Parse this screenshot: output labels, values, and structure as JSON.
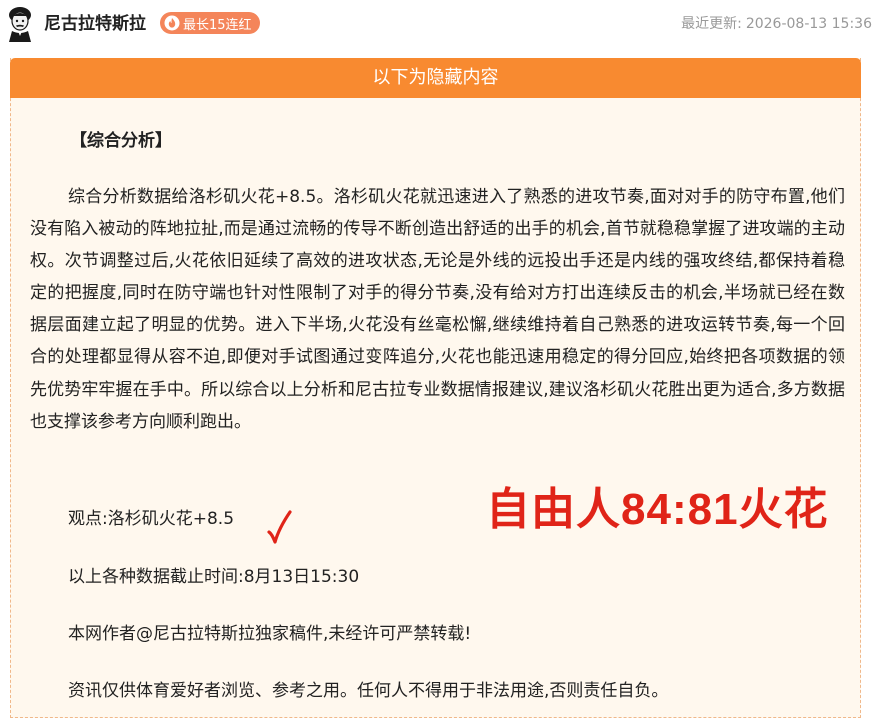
{
  "header": {
    "author_name": "尼古拉特斯拉",
    "streak_label": "最长15连红",
    "update_label": "最近更新:",
    "update_time": "2026-08-13 15:36"
  },
  "icons": {
    "avatar": "tesla-portrait-avatar",
    "badge": "flame-icon",
    "mark": "checkmark-icon"
  },
  "colors": {
    "banner": "#f88a30",
    "badge": "#f4855a",
    "stamp": "#e02418",
    "panel_bg": "#fff8ee"
  },
  "content": {
    "hidden_banner": "以下为隐藏内容",
    "section_title": "【综合分析】",
    "analysis": "综合分析数据给洛杉矶火花+8.5。洛杉矶火花就迅速进入了熟悉的进攻节奏,面对对手的防守布置,他们没有陷入被动的阵地拉扯,而是通过流畅的传导不断创造出舒适的出手的机会,首节就稳稳掌握了进攻端的主动权。次节调整过后,火花依旧延续了高效的进攻状态,无论是外线的远投出手还是内线的强攻终结,都保持着稳定的把握度,同时在防守端也针对性限制了对手的得分节奏,没有给对方打出连续反击的机会,半场就已经在数据层面建立起了明显的优势。进入下半场,火花没有丝毫松懈,继续维持着自己熟悉的进攻运转节奏,每一个回合的处理都显得从容不迫,即便对手试图通过变阵追分,火花也能迅速用稳定的得分回应,始终把各项数据的领先优势牢牢握在手中。所以综合以上分析和尼古拉专业数据情报建议,建议洛杉矶火花胜出更为适合,多方数据也支撑该参考方向顺利跑出。",
    "view_point": "观点:洛杉矶火花+8.5",
    "cutoff_time": "以上各种数据截止时间:8月13日15:30",
    "copyright": "本网作者@尼古拉特斯拉独家稿件,未经许可严禁转载!",
    "disclaimer": "资讯仅供体育爱好者浏览、参考之用。任何人不得用于非法用途,否则责任自负。",
    "result_stamp": "自由人84:81火花"
  }
}
